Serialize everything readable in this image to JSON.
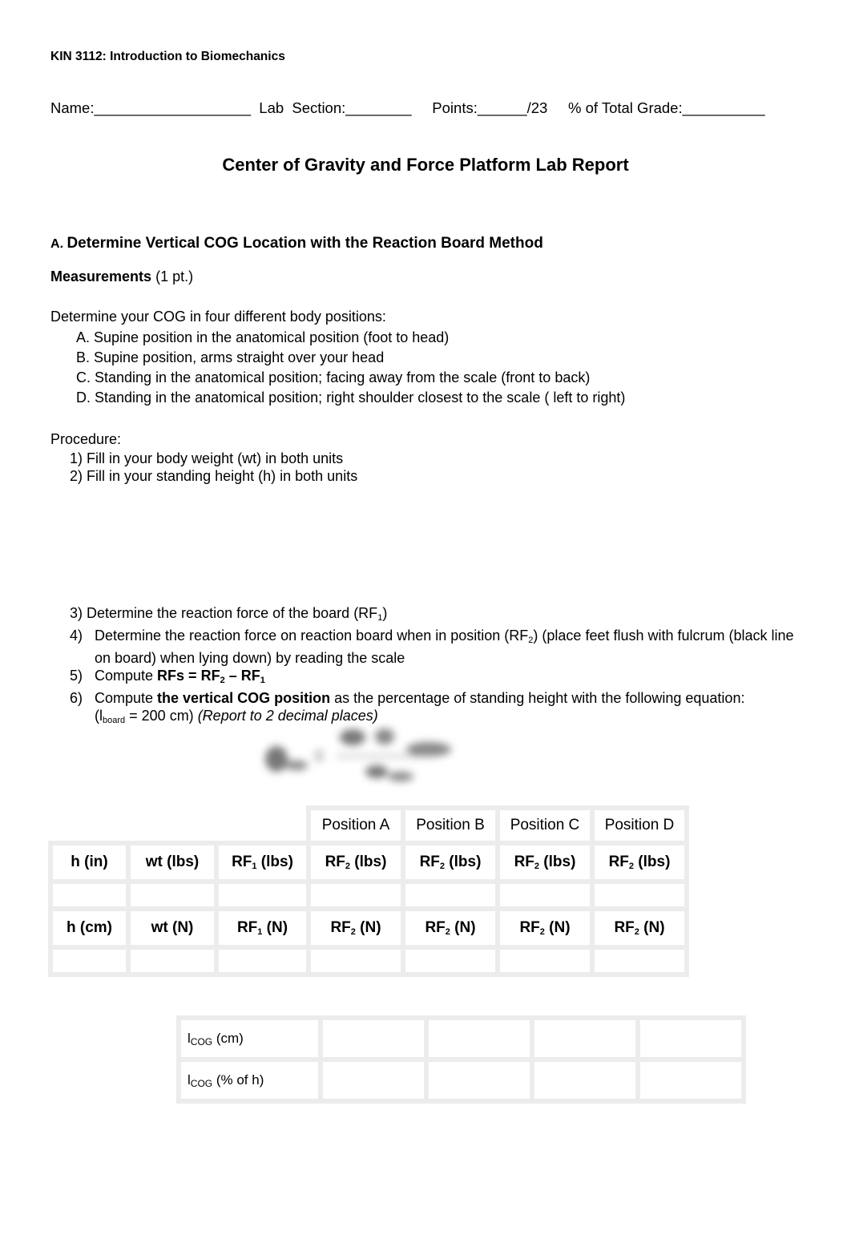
{
  "header": {
    "course": "KIN 3112: Introduction to Biomechanics",
    "name_label": "Name:",
    "name_blank": "___________________",
    "lab_section_label": "Lab  Section:",
    "lab_section_blank": "________",
    "points_label": "Points:",
    "points_blank": "______",
    "points_total": "/23",
    "grade_label": "% of Total Grade:",
    "grade_blank": "__________"
  },
  "title": "Center of Gravity and Force Platform Lab Report",
  "section_a": {
    "letter": "A",
    "heading": "Determine Vertical COG Location with the Reaction Board Method",
    "measurements_label": "Measurements",
    "measurements_points": "(1 pt.)",
    "intro": "Determine your COG in four different body positions:",
    "positions": [
      "A. Supine position in the anatomical position (foot to head)",
      "B. Supine position, arms straight over your head",
      "C. Standing in the anatomical position; facing away from the scale (front  to back)",
      "D. Standing in the anatomical position; right shoulder closest to the scale ( left to right)"
    ],
    "procedure_label": "Procedure:",
    "procedure": [
      "1) Fill in your body weight (wt) in both units",
      "2) Fill in your standing height (h) in both units"
    ],
    "steps": {
      "s3": "3) Determine the reaction force of the board (RF",
      "s3_sub": "1",
      "s3_end": ")",
      "s4_num": "4)",
      "s4_a": "Determine the reaction force on reaction board when in position (RF",
      "s4_sub": "2",
      "s4_b": ") (place feet flush with fulcrum (black line on board) when lying down) by reading the scale",
      "s5_num": "5)",
      "s5_a": "Compute ",
      "s5_bold": "RFs = RF",
      "s5_sub1": "2",
      "s5_mid": " – RF",
      "s5_sub2": "1",
      "s6_num": "6)",
      "s6_a": "Compute ",
      "s6_bold": "the vertical COG position",
      "s6_b": " as the percentage of standing height with the following equation:",
      "s6_c1": "(l",
      "s6_c_sub": "board",
      "s6_c2": " = 200 cm) ",
      "s6_italic": "(Report to 2 decimal places)"
    }
  },
  "table1": {
    "position_headers": [
      "Position A",
      "Position B",
      "Position C",
      "Position D"
    ],
    "row_imperial": [
      {
        "main": "h (in)",
        "sub": "",
        "unit": ""
      },
      {
        "main": "wt (lbs)",
        "sub": "",
        "unit": ""
      },
      {
        "main": "RF",
        "sub": "1",
        "unit": " (lbs)"
      },
      {
        "main": "RF",
        "sub": "2",
        "unit": " (lbs)"
      },
      {
        "main": "RF",
        "sub": "2",
        "unit": " (lbs)"
      },
      {
        "main": "RF",
        "sub": "2",
        "unit": " (lbs)"
      },
      {
        "main": "RF",
        "sub": "2",
        "unit": " (lbs)"
      }
    ],
    "row_metric": [
      {
        "main": "h (cm)",
        "sub": "",
        "unit": ""
      },
      {
        "main": "wt (N)",
        "sub": "",
        "unit": ""
      },
      {
        "main": "RF",
        "sub": "1",
        "unit": " (N)"
      },
      {
        "main": "RF",
        "sub": "2",
        "unit": " (N)"
      },
      {
        "main": "RF",
        "sub": "2",
        "unit": " (N)"
      },
      {
        "main": "RF",
        "sub": "2",
        "unit": " (N)"
      },
      {
        "main": "RF",
        "sub": "2",
        "unit": " (N)"
      }
    ]
  },
  "table2": {
    "rows": [
      {
        "l": "l",
        "sub": "COG",
        "unit": " (cm)"
      },
      {
        "l": "l",
        "sub": "COG",
        "unit": " (% of h)"
      }
    ]
  }
}
